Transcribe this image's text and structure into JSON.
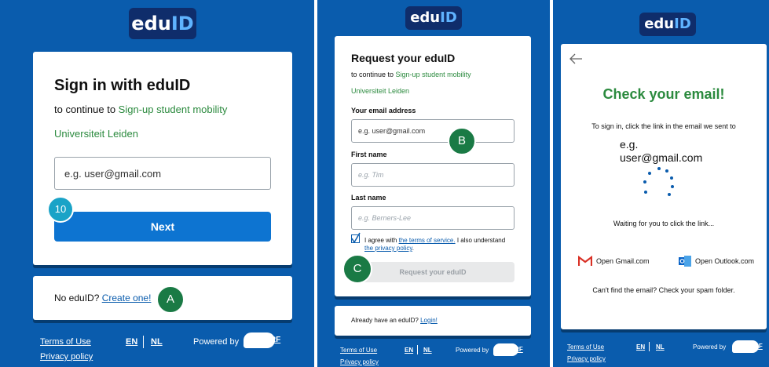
{
  "panel1": {
    "logo": {
      "pre": "edu",
      "post": "ID"
    },
    "title": "Sign in with eduID",
    "continue_prefix": "to continue to ",
    "service": "Sign-up student mobility",
    "institution": "Universiteit Leiden",
    "email_placeholder": "e.g. user@gmail.com",
    "step_badge": "10",
    "next_button": "Next",
    "no_account_text": "No eduID?",
    "create_link": "Create one!",
    "marker_a": "A",
    "footer": {
      "terms": "Terms of Use",
      "privacy": "Privacy policy",
      "lang_en": "EN",
      "lang_nl": "NL",
      "powered_by": "Powered by",
      "surf": "SURF"
    }
  },
  "panel2": {
    "logo": {
      "pre": "edu",
      "post": "ID"
    },
    "title": "Request your eduID",
    "continue_prefix": "to continue to ",
    "service": "Sign-up student mobility",
    "institution": "Universiteit Leiden",
    "email_label": "Your email address",
    "email_value": "e.g. user@gmail.com",
    "marker_b": "B",
    "first_name_label": "First name",
    "first_name_placeholder": "e.g. Tim",
    "last_name_label": "Last name",
    "last_name_placeholder": "e.g. Berners-Lee",
    "agree_prefix": "I agree with ",
    "terms_link": "the terms of service.",
    "agree_middle": " I also understand ",
    "privacy_link": "the privacy policy",
    "agree_suffix": ".",
    "marker_c": "C",
    "request_button": "Request your eduID",
    "have_account_text": "Already have an eduID?",
    "login_link": "Login!",
    "footer": {
      "terms": "Terms of Use",
      "privacy": "Privacy policy",
      "lang_en": "EN",
      "lang_nl": "NL",
      "powered_by": "Powered by",
      "surf": "SURF"
    }
  },
  "panel3": {
    "logo": {
      "pre": "edu",
      "post": "ID"
    },
    "back_icon": "arrow-left-icon",
    "title": "Check your email!",
    "instruction": "To sign in, click the link in the email we sent to",
    "email_line1": "e.g.",
    "email_line2": "user@gmail.com",
    "waiting": "Waiting for you to click the link...",
    "gmail": "Open Gmail.com",
    "outlook": "Open Outlook.com",
    "spam_hint": "Can't find the email? Check your spam folder.",
    "footer": {
      "terms": "Terms of Use",
      "privacy": "Privacy policy",
      "lang_en": "EN",
      "lang_nl": "NL",
      "powered_by": "Powered by",
      "surf": "SURF"
    }
  },
  "colors": {
    "brand_blue": "#0a5cad",
    "logo_navy": "#0f2d6b",
    "success_green": "#2b8a3e",
    "marker_green": "#1a7a45",
    "badge_teal": "#1aa3c7"
  }
}
